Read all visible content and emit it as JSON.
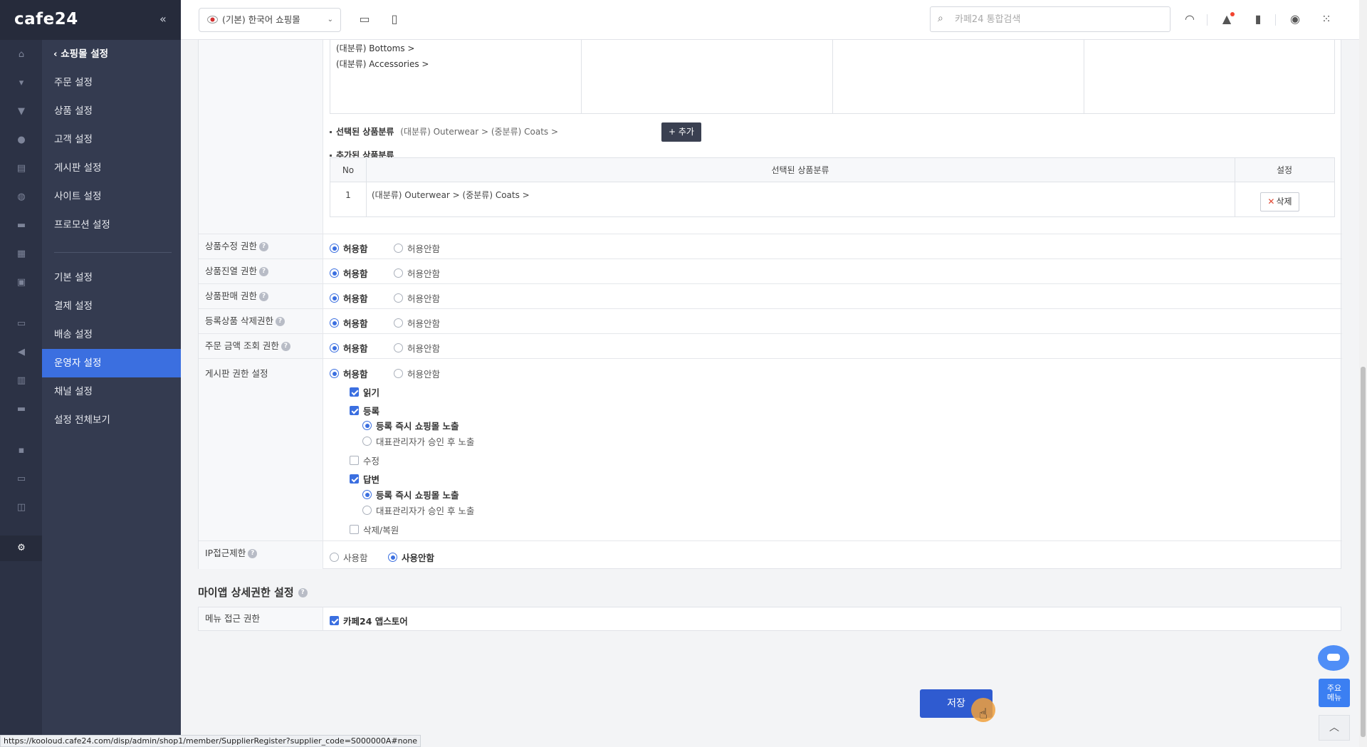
{
  "brand": {
    "logo": "cafe24",
    "collapse_icon": "«"
  },
  "header": {
    "mall_select": "(기본) 한국어 쇼핑몰",
    "search_placeholder": "카페24 통합검색"
  },
  "subnav": {
    "back": "쇼핑몰 설정",
    "items": [
      "주문 설정",
      "상품 설정",
      "고객 설정",
      "게시판 설정",
      "사이트 설정",
      "프로모션 설정"
    ],
    "items2": [
      "기본 설정",
      "결제 설정",
      "배송 설정",
      "운영자 설정",
      "채널 설정",
      "설정 전체보기"
    ],
    "active": "운영자 설정"
  },
  "category_picker": {
    "lines": [
      "(대분류) Bottoms >",
      "(대분류) Accessories >"
    ]
  },
  "selected_category": {
    "label": "선택된 상품분류",
    "path": "(대분류) Outerwear > (중분류) Coats >",
    "add_button": "추가"
  },
  "added_category": {
    "label": "추가된 상품분류",
    "headers": {
      "no": "No",
      "selected": "선택된 상품분류",
      "setting": "설정"
    },
    "rows": [
      {
        "no": "1",
        "path": "(대분류) Outerwear > (중분류) Coats >",
        "delete": "삭제"
      }
    ]
  },
  "permissions": {
    "allow": "허용함",
    "deny": "허용안함",
    "rows": [
      {
        "label": "상품수정 권한",
        "value": "허용함"
      },
      {
        "label": "상품진열 권한",
        "value": "허용함"
      },
      {
        "label": "상품판매 권한",
        "value": "허용함"
      },
      {
        "label": "등록상품 삭제권한",
        "value": "허용함"
      },
      {
        "label": "주문 금액 조회 권한",
        "value": "허용함"
      }
    ]
  },
  "board": {
    "label": "게시판 권한 설정",
    "value": "허용함",
    "read": "읽기",
    "register": "등록",
    "expose_now": "등록 즉시 쇼핑몰 노출",
    "expose_after": "대표관리자가 승인 후 노출",
    "edit": "수정",
    "reply": "답변",
    "delete_restore": "삭제/복원"
  },
  "ip": {
    "label": "IP접근제한",
    "use": "사용함",
    "not_use": "사용안함",
    "value": "사용안함"
  },
  "myapp": {
    "title": "마이앱 상세권한 설정",
    "menu_label": "메뉴 접근 권한",
    "store": "카페24 앱스토어"
  },
  "save_button": "저장",
  "float": {
    "menu": "주요\n메뉴"
  },
  "status_url": "https://kooloud.cafe24.com/disp/admin/shop1/member/SupplierRegister?supplier_code=S000000A#none",
  "colors": {
    "accent": "#3b6fe0",
    "sidebar": "#343b50",
    "rail": "#2c3245",
    "save": "#2f5bd0"
  }
}
